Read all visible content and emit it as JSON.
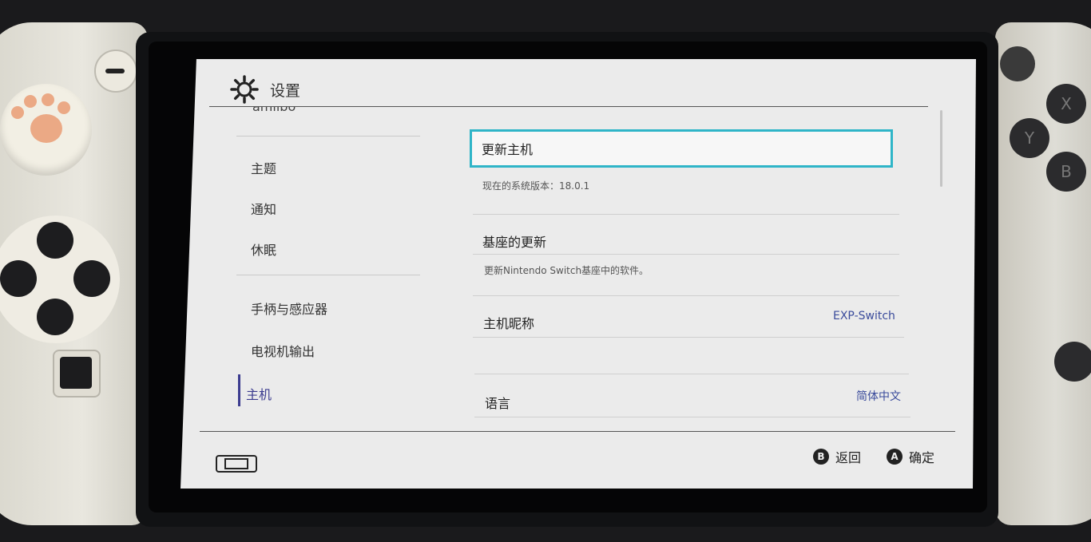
{
  "header": {
    "title": "设置",
    "icon": "gear-icon"
  },
  "sidebar": {
    "cut_off_item": "amiibo",
    "items": [
      {
        "label": "主题"
      },
      {
        "label": "通知"
      },
      {
        "label": "休眠"
      },
      {
        "label": "手柄与感应器"
      },
      {
        "label": "电视机输出"
      },
      {
        "label": "主机",
        "active": true
      }
    ]
  },
  "main": {
    "update_console": {
      "label": "更新主机",
      "description": "现在的系统版本：18.0.1"
    },
    "dock_update": {
      "label": "基座的更新",
      "description": "更新Nintendo Switch基座中的软件。"
    },
    "console_nickname": {
      "label": "主机昵称",
      "value": "EXP-Switch"
    },
    "language": {
      "label": "语言",
      "value": "简体中文"
    }
  },
  "footer": {
    "back": {
      "key": "B",
      "label": "返回"
    },
    "confirm": {
      "key": "A",
      "label": "确定"
    }
  },
  "colors": {
    "accent": "#2fb5c8",
    "active": "#3b3b8f",
    "value": "#3b4c9c",
    "screen_bg": "#ebebeb"
  }
}
